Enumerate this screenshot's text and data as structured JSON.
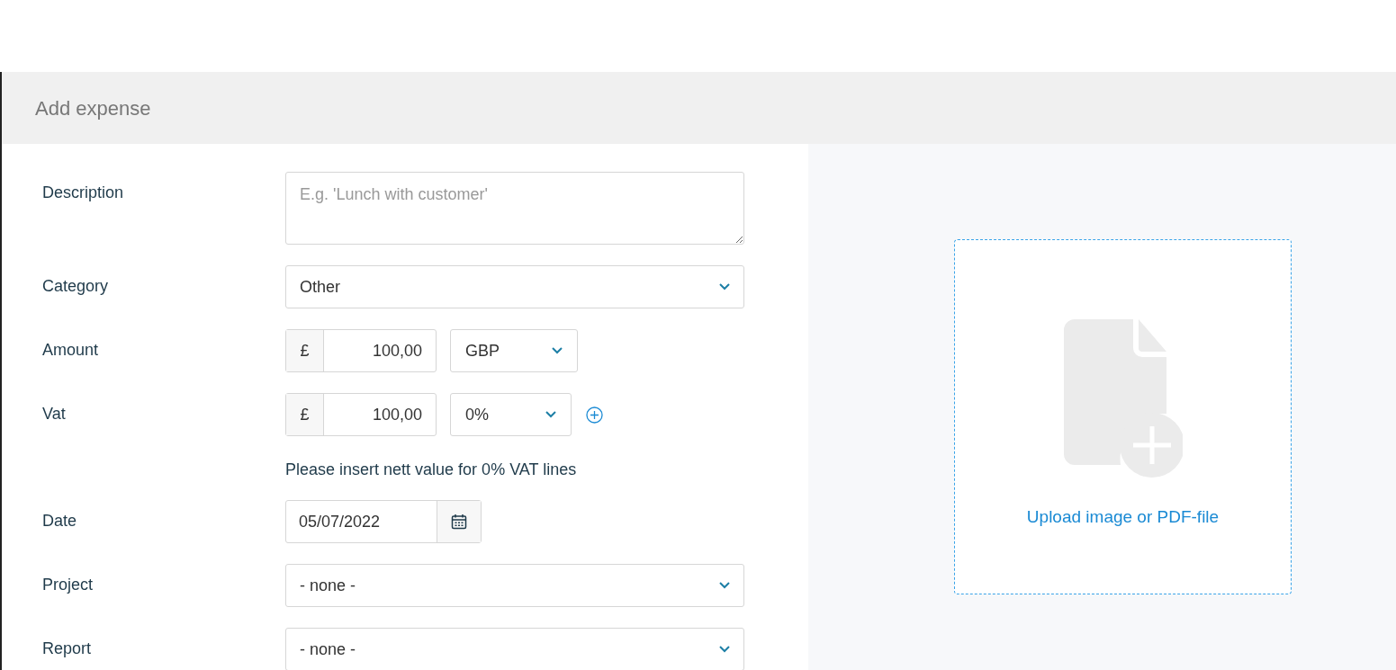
{
  "header": {
    "title": "Add expense"
  },
  "fields": [
    {
      "kind": "textarea",
      "label": "Description",
      "placeholder": "E.g. 'Lunch with customer'"
    },
    {
      "kind": "select",
      "label": "Category",
      "value": "Other"
    },
    {
      "kind": "money",
      "label": "Amount",
      "prefix": "£",
      "value": "100,00",
      "option": "GBP",
      "add_button": false
    },
    {
      "kind": "money",
      "label": "Vat",
      "prefix": "£",
      "value": "100,00",
      "option": "0%",
      "add_button": true,
      "hint": "Please insert nett value for 0% VAT lines"
    },
    {
      "kind": "date",
      "label": "Date",
      "value": "05/07/2022"
    },
    {
      "kind": "select",
      "label": "Project",
      "value": "- none -"
    },
    {
      "kind": "select",
      "label": "Report",
      "value": "- none -"
    }
  ],
  "upload": {
    "label": "Upload image or PDF-file"
  }
}
